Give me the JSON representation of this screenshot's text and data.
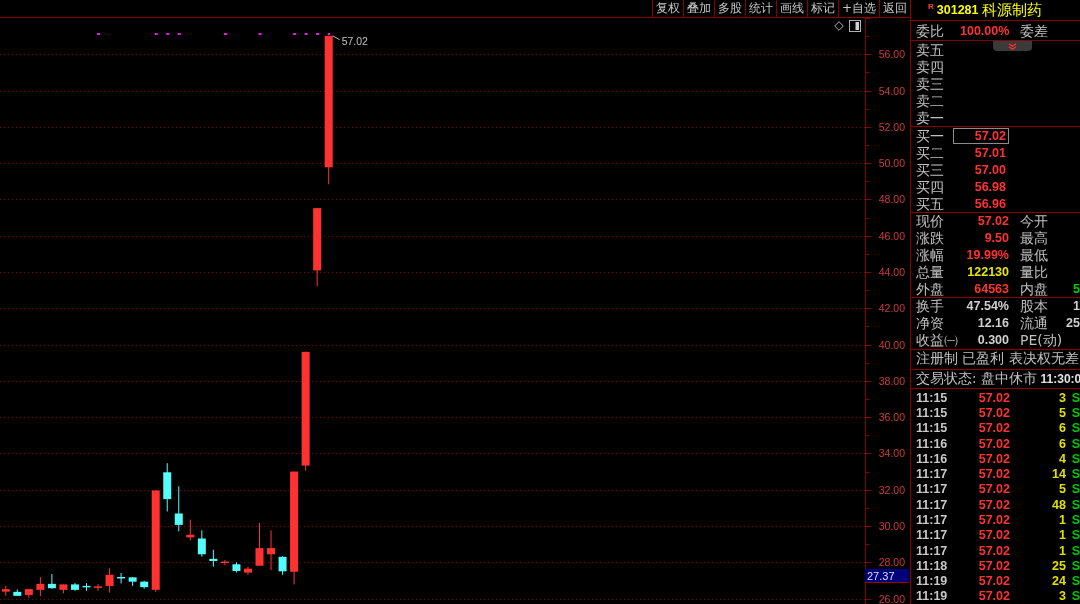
{
  "toolbar": {
    "buttons": [
      "复权",
      "叠加",
      "多股",
      "统计",
      "画线",
      "标记",
      "+自选",
      "返回"
    ]
  },
  "chart": {
    "price_tag": "27.37",
    "chart_data": [
      {
        "type": "candlestick",
        "ylim": [
          25.7,
          58.0
        ],
        "grid": true,
        "yticks": [
          {
            "value": 26,
            "label": "26.00"
          },
          {
            "value": 28,
            "label": "28.00"
          },
          {
            "value": 30,
            "label": "30.00"
          },
          {
            "value": 32,
            "label": "32.00"
          },
          {
            "value": 34,
            "label": "34.00"
          },
          {
            "value": 36,
            "label": "36.00"
          },
          {
            "value": 38,
            "label": "38.00"
          },
          {
            "value": 40,
            "label": "40.00"
          },
          {
            "value": 42,
            "label": "42.00"
          },
          {
            "value": 44,
            "label": "44.00"
          },
          {
            "value": 46,
            "label": "46.00"
          },
          {
            "value": 48,
            "label": "48.00"
          },
          {
            "value": 50,
            "label": "50.00"
          },
          {
            "value": 52,
            "label": "52.00"
          },
          {
            "value": 54,
            "label": "54.00"
          },
          {
            "value": 56,
            "label": "56.00"
          }
        ],
        "ohlc": [
          [
            26.38,
            26.7,
            26.15,
            26.52
          ],
          [
            26.37,
            26.5,
            26.15,
            26.15
          ],
          [
            26.2,
            26.52,
            26.04,
            26.52
          ],
          [
            26.48,
            27.19,
            26.13,
            26.81
          ],
          [
            26.81,
            27.35,
            26.54,
            26.57
          ],
          [
            26.48,
            26.78,
            26.28,
            26.78
          ],
          [
            26.78,
            26.85,
            26.43,
            26.48
          ],
          [
            26.7,
            26.85,
            26.43,
            26.65
          ],
          [
            26.61,
            26.8,
            26.43,
            26.67
          ],
          [
            26.69,
            27.67,
            26.33,
            27.31
          ],
          [
            27.19,
            27.41,
            26.83,
            27.11
          ],
          [
            27.17,
            27.17,
            26.7,
            26.93
          ],
          [
            26.93,
            26.98,
            26.54,
            26.63
          ],
          [
            26.48,
            31.96,
            26.37,
            31.96
          ],
          [
            32.96,
            33.46,
            30.8,
            31.48
          ],
          [
            30.69,
            32.19,
            29.7,
            30.06
          ],
          [
            29.37,
            30.35,
            29.2,
            29.52
          ],
          [
            29.31,
            29.76,
            28.31,
            28.44
          ],
          [
            28.19,
            28.69,
            27.76,
            28.07
          ],
          [
            27.96,
            28.13,
            27.83,
            28.04
          ],
          [
            27.89,
            28.0,
            27.43,
            27.52
          ],
          [
            27.43,
            27.76,
            27.31,
            27.65
          ],
          [
            27.81,
            30.17,
            27.81,
            28.78
          ],
          [
            28.44,
            29.76,
            27.57,
            28.78
          ],
          [
            28.3,
            28.33,
            27.31,
            27.5
          ],
          [
            27.48,
            33.0,
            26.78,
            33.0
          ],
          [
            33.33,
            39.6,
            33.05,
            39.6
          ],
          [
            44.09,
            47.52,
            43.2,
            47.52
          ],
          [
            49.77,
            57.02,
            48.83,
            57.02
          ],
          null,
          null,
          null,
          null,
          null,
          null,
          null,
          null,
          null,
          null,
          null,
          null,
          null,
          null,
          null,
          null,
          null,
          null,
          null,
          null,
          null,
          null,
          null,
          null,
          null,
          null,
          null,
          null,
          null,
          null,
          null,
          null,
          null,
          null,
          null,
          null,
          null,
          null,
          null,
          null,
          null,
          null,
          null,
          null,
          null,
          null
        ],
        "annotations": [
          "57.02"
        ]
      }
    ]
  },
  "quote": {
    "flag": "R",
    "code": "301281",
    "name": "科源制药",
    "order_ratio": {
      "label": "委比",
      "value": "100.00%",
      "right": {
        "label": "委差"
      }
    },
    "asks": [
      "卖五",
      "卖四",
      "卖三",
      "卖二",
      "卖一"
    ],
    "bids": [
      {
        "label": "买一",
        "price": "57.02",
        "selected": true
      },
      {
        "label": "买二",
        "price": "57.01",
        "selected": false
      },
      {
        "label": "买三",
        "price": "57.00",
        "selected": false
      },
      {
        "label": "买四",
        "price": "56.98",
        "selected": false
      },
      {
        "label": "买五",
        "price": "56.96",
        "selected": false
      }
    ],
    "stats": [
      {
        "label": "现价",
        "value": "57.02",
        "color": "#ff3232",
        "right": {
          "label": "今开"
        }
      },
      {
        "label": "涨跌",
        "value": "9.50",
        "color": "#ff3232",
        "right": {
          "label": "最高"
        }
      },
      {
        "label": "涨幅",
        "value": "19.99%",
        "color": "#ff3232",
        "right": {
          "label": "最低"
        }
      },
      {
        "label": "总量",
        "value": "122130",
        "color": "#e6e600",
        "right": {
          "label": "量比"
        }
      },
      {
        "label": "外盘",
        "value": "64563",
        "color": "#ff3232",
        "right": {
          "label": "内盘",
          "value": "5",
          "color": "#00d000"
        }
      }
    ],
    "fundamentals": [
      {
        "label": "换手",
        "value": "47.54%",
        "right": {
          "label": "股本",
          "value": "1"
        }
      },
      {
        "label": "净资",
        "value": "12.16",
        "right": {
          "label": "流通",
          "value": "25"
        }
      },
      {
        "label": "收益㈠",
        "value": "0.300",
        "right": {
          "label": "PE(动)"
        }
      }
    ],
    "tags": "注册制 已盈利 表决权无差",
    "trade_status": {
      "label": "交易状态:",
      "value": "盘中休市",
      "time": "11:30:0"
    },
    "trades": [
      {
        "time": "11:15",
        "price": "57.02",
        "volume": "3",
        "side": "S"
      },
      {
        "time": "11:15",
        "price": "57.02",
        "volume": "5",
        "side": "S"
      },
      {
        "time": "11:15",
        "price": "57.02",
        "volume": "6",
        "side": "S"
      },
      {
        "time": "11:16",
        "price": "57.02",
        "volume": "6",
        "side": "S"
      },
      {
        "time": "11:16",
        "price": "57.02",
        "volume": "4",
        "side": "S"
      },
      {
        "time": "11:17",
        "price": "57.02",
        "volume": "14",
        "side": "S"
      },
      {
        "time": "11:17",
        "price": "57.02",
        "volume": "5",
        "side": "S"
      },
      {
        "time": "11:17",
        "price": "57.02",
        "volume": "48",
        "side": "S"
      },
      {
        "time": "11:17",
        "price": "57.02",
        "volume": "1",
        "side": "S"
      },
      {
        "time": "11:17",
        "price": "57.02",
        "volume": "1",
        "side": "S"
      },
      {
        "time": "11:17",
        "price": "57.02",
        "volume": "1",
        "side": "S"
      },
      {
        "time": "11:18",
        "price": "57.02",
        "volume": "25",
        "side": "S"
      },
      {
        "time": "11:19",
        "price": "57.02",
        "volume": "24",
        "side": "S"
      },
      {
        "time": "11:19",
        "price": "57.02",
        "volume": "3",
        "side": "S"
      }
    ]
  }
}
